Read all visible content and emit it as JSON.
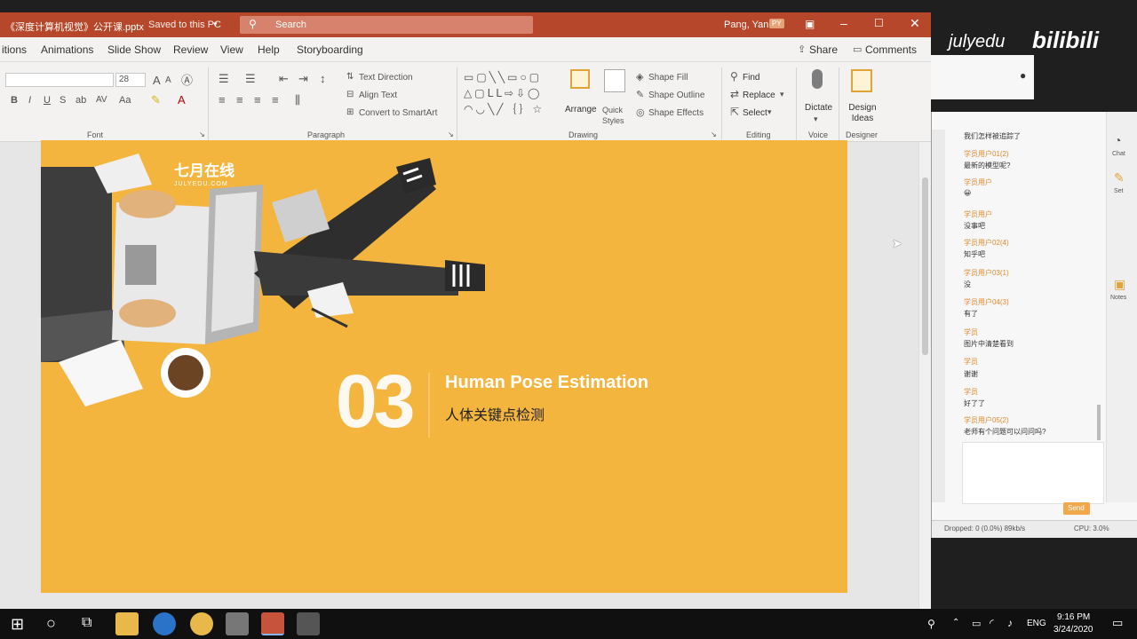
{
  "titlebar": {
    "filename": "《深度计算机视觉》公开课.pptx",
    "save_status": "Saved to this PC",
    "search_placeholder": "Search",
    "user": "Pang, Yan",
    "user_initials": "PY"
  },
  "tabs": [
    "itions",
    "Animations",
    "Slide Show",
    "Review",
    "View",
    "Help",
    "Storyboarding"
  ],
  "share_label": "Share",
  "comments_label": "Comments",
  "ribbon": {
    "font_size": "28",
    "groups": {
      "font": "Font",
      "paragraph": "Paragraph",
      "drawing": "Drawing",
      "editing": "Editing",
      "voice": "Voice",
      "designer": "Designer"
    },
    "paragraph_items": [
      "Text Direction",
      "Align Text",
      "Convert to SmartArt"
    ],
    "drawing_items": [
      "Shape Fill",
      "Shape Outline",
      "Shape Effects"
    ],
    "arrange": "Arrange",
    "quick_styles": "Quick Styles",
    "find": "Find",
    "replace": "Replace",
    "select": "Select",
    "dictate": "Dictate",
    "design_ideas": "Design Ideas"
  },
  "slide": {
    "logo_text": "七月在线",
    "logo_sub": "JULYEDU.COM",
    "section_number": "03",
    "title_en": "Human Pose Estimation",
    "title_cn": "人体关键点检测"
  },
  "watermark": {
    "text1": "julyedu",
    "text2": "bilibili"
  },
  "chat": {
    "messages": [
      {
        "name": "",
        "text": "我们怎样被追踪了"
      },
      {
        "name": "学员用户01(2)",
        "text": "最新的模型呢?"
      },
      {
        "name": "学员用户",
        "text": "😀"
      },
      {
        "name": "学员用户",
        "text": "没事吧"
      },
      {
        "name": "学员用户02(4)",
        "text": "知乎吧"
      },
      {
        "name": "学员用户03(1)",
        "text": "没"
      },
      {
        "name": "学员用户04(3)",
        "text": "有了"
      },
      {
        "name": "学员",
        "text": "图片中清楚看到"
      },
      {
        "name": "学员",
        "text": "谢谢"
      },
      {
        "name": "学员",
        "text": "好了了"
      },
      {
        "name": "学员用户05(2)",
        "text": "老师有个问题可以问问吗?"
      }
    ],
    "side_labels": [
      "Chat",
      "Set",
      "Notes"
    ],
    "send_label": "Send",
    "status_left": "Dropped: 0 (0.0%)  89kb/s",
    "status_right": "CPU: 3.0%"
  },
  "taskbar": {
    "lang": "ENG",
    "time": "9:16 PM",
    "date": "3/24/2020"
  },
  "colors": {
    "ppt_red": "#b7472a",
    "slide_bg": "#f4b53f",
    "chat_name": "#e08a2e"
  }
}
